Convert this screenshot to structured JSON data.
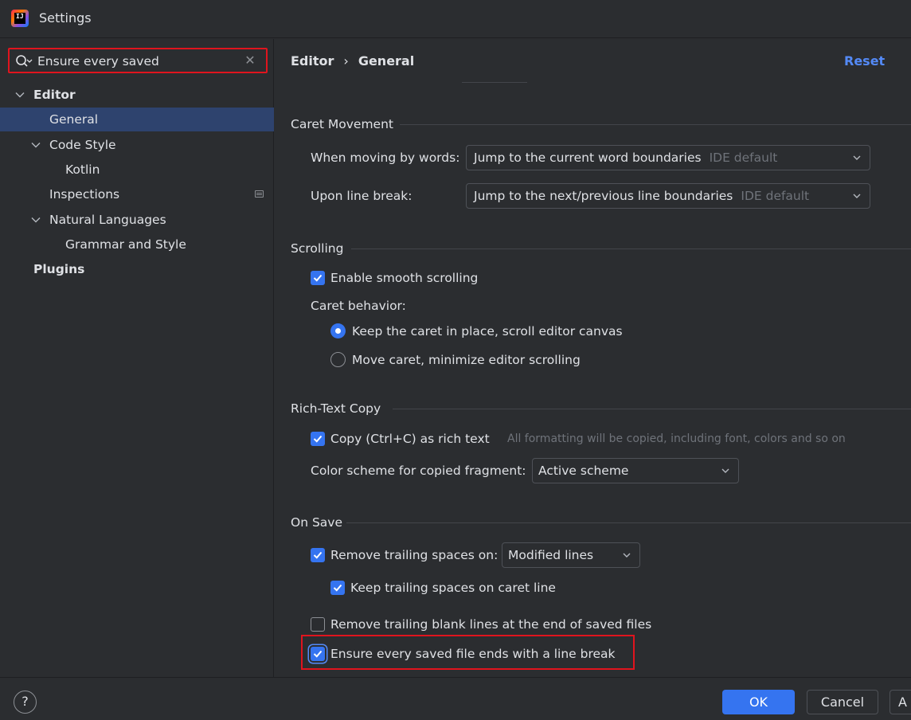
{
  "window": {
    "title": "Settings",
    "logo_text": "IJ"
  },
  "search": {
    "value": "Ensure every saved",
    "clear_glyph": "✕"
  },
  "tree": {
    "editor": "Editor",
    "general": "General",
    "code_style": "Code Style",
    "kotlin": "Kotlin",
    "inspections": "Inspections",
    "natural_languages": "Natural Languages",
    "grammar_and_style": "Grammar and Style",
    "plugins": "Plugins"
  },
  "header": {
    "breadcrumb_parent": "Editor",
    "breadcrumb_sep": "›",
    "breadcrumb_current": "General",
    "reset": "Reset"
  },
  "caret_movement": {
    "title": "Caret Movement",
    "words_label": "When moving by words:",
    "words_value": "Jump to the current word boundaries",
    "words_hint": "IDE default",
    "linebreak_label": "Upon line break:",
    "linebreak_value": "Jump to the next/previous line boundaries",
    "linebreak_hint": "IDE default"
  },
  "scrolling": {
    "title": "Scrolling",
    "smooth": "Enable smooth scrolling",
    "smooth_checked": true,
    "caret_behavior": "Caret behavior:",
    "option_keep": "Keep the caret in place, scroll editor canvas",
    "option_move": "Move caret, minimize editor scrolling",
    "selected": "keep"
  },
  "rich_text": {
    "title": "Rich-Text Copy",
    "copy": "Copy (Ctrl+C) as rich text",
    "copy_checked": true,
    "copy_note": "All formatting will be copied, including font, colors and so on",
    "scheme_label": "Color scheme for copied fragment:",
    "scheme_value": "Active scheme"
  },
  "on_save": {
    "title": "On Save",
    "trailing": "Remove trailing spaces on:",
    "trailing_checked": true,
    "trailing_value": "Modified lines",
    "keep_caret": "Keep trailing spaces on caret line",
    "keep_caret_checked": true,
    "blank_lines": "Remove trailing blank lines at the end of saved files",
    "blank_lines_checked": false,
    "line_break": "Ensure every saved file ends with a line break",
    "line_break_checked": true
  },
  "footer": {
    "help": "?",
    "ok": "OK",
    "cancel": "Cancel",
    "apply": "A"
  },
  "colors": {
    "background": "#2b2d30",
    "selection": "#2e436e",
    "accent": "#3574f0",
    "link": "#548af7",
    "highlight_border": "#e0141e"
  }
}
